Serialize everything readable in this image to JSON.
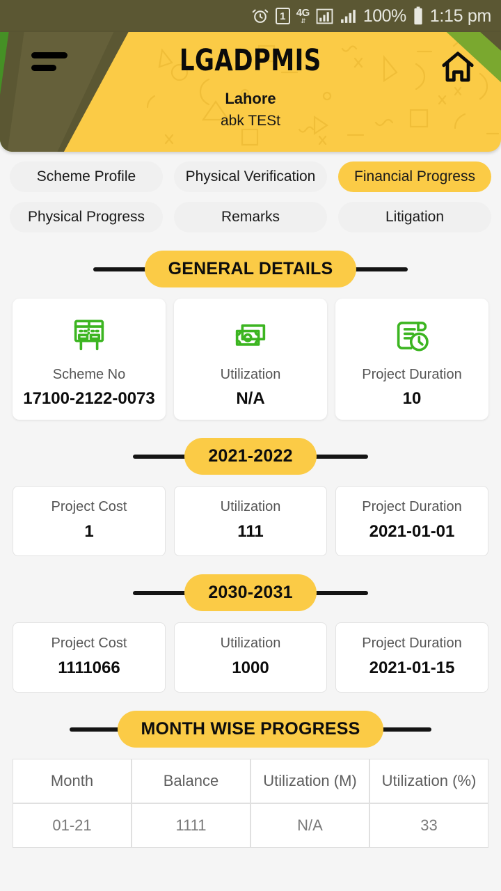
{
  "status_bar": {
    "alarm_icon": "alarm-clock-icon",
    "sim_label": "1",
    "network": "4G",
    "network_arrows": "⇵",
    "signal_icon_1": "signal-bars-boxed-icon",
    "signal_icon_2": "signal-bars-icon",
    "battery_percent": "100%",
    "battery_icon": "battery-full-icon",
    "time": "1:15 pm"
  },
  "header": {
    "menu_icon": "hamburger-menu-icon",
    "home_icon": "home-icon",
    "title": "LGADPMIS",
    "district": "Lahore",
    "scheme_name": "abk TESt",
    "accent_color": "#fbcb46",
    "decor_color": "#5b5733",
    "decor_green": "#55a229"
  },
  "tabs": [
    {
      "label": "Scheme Profile",
      "active": false
    },
    {
      "label": "Physical Verification",
      "active": false
    },
    {
      "label": "Financial Progress",
      "active": true
    },
    {
      "label": "Physical Progress",
      "active": false
    },
    {
      "label": "Remarks",
      "active": false
    },
    {
      "label": "Litigation",
      "active": false
    }
  ],
  "general_details": {
    "section_title": "GENERAL DETAILS",
    "cards": [
      {
        "icon": "signboard-icon",
        "label": "Scheme No",
        "value": "17100-2122-0073"
      },
      {
        "icon": "banknote-icon",
        "label": "Utilization",
        "value": "N/A"
      },
      {
        "icon": "scroll-clock-icon",
        "label": "Project Duration",
        "value": "10"
      }
    ]
  },
  "year_sections": [
    {
      "section_title": "2021-2022",
      "cards": [
        {
          "label": "Project Cost",
          "value": "1"
        },
        {
          "label": "Utilization",
          "value": "111"
        },
        {
          "label": "Project Duration",
          "value": "2021-01-01"
        }
      ]
    },
    {
      "section_title": "2030-2031",
      "cards": [
        {
          "label": "Project Cost",
          "value": "1111066"
        },
        {
          "label": "Utilization",
          "value": "1000"
        },
        {
          "label": "Project Duration",
          "value": "2021-01-15"
        }
      ]
    }
  ],
  "month_wise_progress": {
    "section_title": "MONTH WISE PROGRESS",
    "columns": [
      "Month",
      "Balance",
      "Utilization (M)",
      "Utilization (%)"
    ],
    "rows": [
      [
        "01-21",
        "1111",
        "N/A",
        "33"
      ]
    ]
  }
}
